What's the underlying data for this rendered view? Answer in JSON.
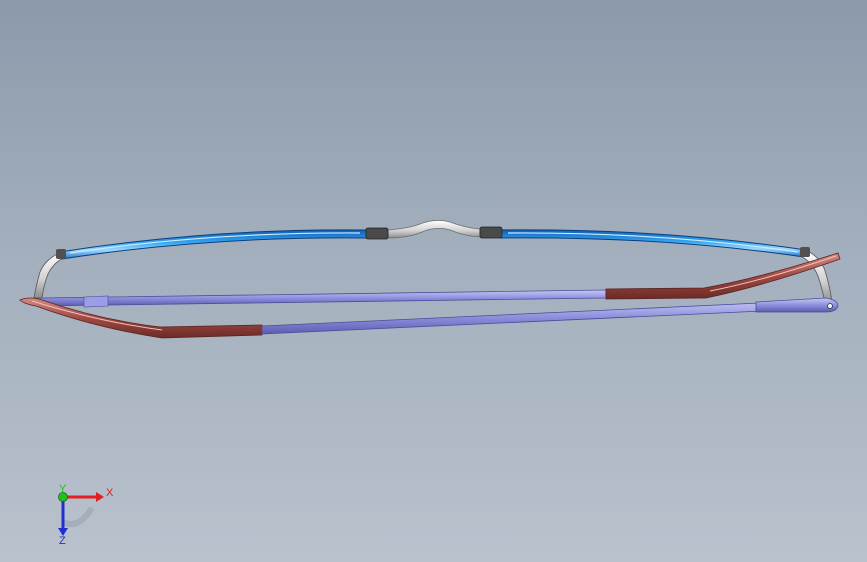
{
  "viewport": {
    "background_top": "#8b9aab",
    "background_bottom": "#b9c2cd"
  },
  "model": {
    "lens_color": "#1f8fe0",
    "bridge_color": "#d8d8d8",
    "temple_color": "#8f90dd",
    "tip_color": "#a04a44",
    "hinge_color": "#4a4a4a"
  },
  "triad": {
    "x_label": "X",
    "y_label": "Y",
    "z_label": "Z",
    "x_color": "#e02020",
    "y_color": "#20c020",
    "z_color": "#2030d0"
  }
}
